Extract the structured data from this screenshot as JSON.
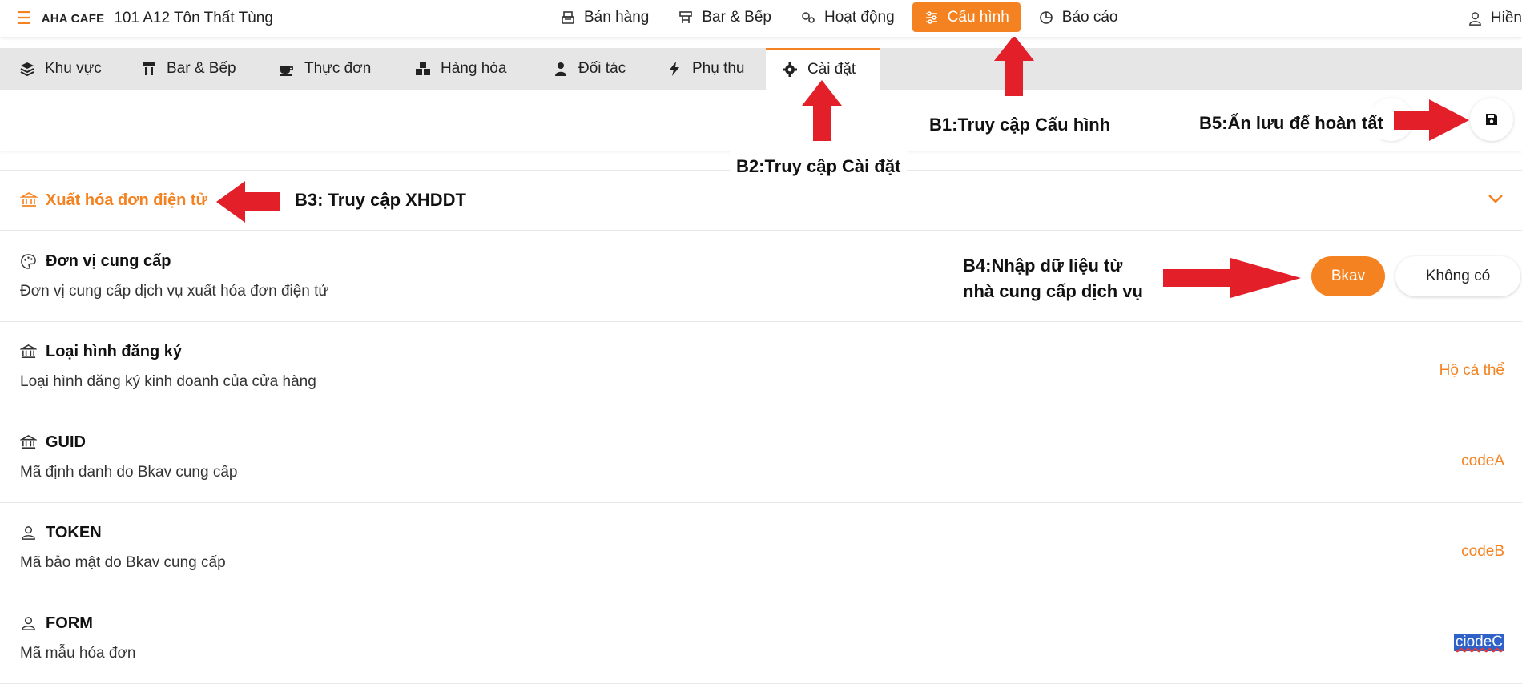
{
  "topbar": {
    "brand": "AHA CAFE",
    "branch": "101 A12 Tôn Thất Tùng",
    "nav": [
      {
        "label": "Bán hàng",
        "icon": "register-icon"
      },
      {
        "label": "Bar & Bếp",
        "icon": "kitchen-icon"
      },
      {
        "label": "Hoạt động",
        "icon": "gears-icon"
      },
      {
        "label": "Cấu hình",
        "icon": "sliders-icon",
        "active": true
      },
      {
        "label": "Báo cáo",
        "icon": "pie-chart-icon"
      }
    ],
    "user": "Hiền"
  },
  "tabs": [
    {
      "label": "Khu vực",
      "icon": "layers-icon"
    },
    {
      "label": "Bar & Bếp",
      "icon": "counter-icon"
    },
    {
      "label": "Thực đơn",
      "icon": "coffee-icon"
    },
    {
      "label": "Hàng hóa",
      "icon": "boxes-icon"
    },
    {
      "label": "Đối tác",
      "icon": "partner-icon"
    },
    {
      "label": "Phụ thu",
      "icon": "bolt-icon"
    },
    {
      "label": "Cài đặt",
      "icon": "gear-icon",
      "active": true
    }
  ],
  "section": {
    "title": "Xuất hóa đơn điện tử"
  },
  "rows": [
    {
      "title": "Đơn vị cung cấp",
      "desc": "Đơn vị cung cấp dịch vụ xuất hóa đơn điện tử",
      "options": [
        "Bkav",
        "Không có"
      ],
      "selected": "Bkav"
    },
    {
      "title": "Loại hình đăng ký",
      "desc": "Loại hình đăng ký kinh doanh của cửa hàng",
      "value": "Hộ cá thể"
    },
    {
      "title": "GUID",
      "desc": "Mã định danh do Bkav cung cấp",
      "value": "codeA"
    },
    {
      "title": "TOKEN",
      "desc": "Mã bảo mật do Bkav cung cấp",
      "value": "codeB"
    },
    {
      "title": "FORM",
      "desc": "Mã mẫu hóa đơn",
      "value": "ciodeC"
    }
  ],
  "annotations": {
    "b1": "B1:Truy cập Cấu hình",
    "b2": "B2:Truy cập Cài đặt",
    "b3": "B3: Truy cập XHDDT",
    "b4_line1": "B4:Nhập dữ liệu từ",
    "b4_line2": "nhà cung cấp dịch vụ",
    "b5": "B5:Ấn lưu để hoàn tất"
  },
  "colors": {
    "accent": "#f58220",
    "arrow": "#e3202a",
    "selection": "#2f62c8"
  }
}
